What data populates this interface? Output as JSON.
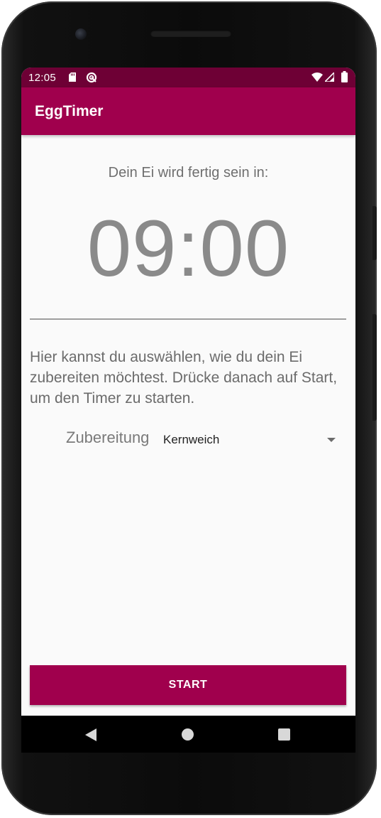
{
  "status_bar": {
    "time": "12:05",
    "icons": [
      "sd-card-icon",
      "sync-icon",
      "wifi-icon",
      "signal-icon",
      "battery-icon"
    ],
    "background": "#6e0035"
  },
  "app_bar": {
    "title": "EggTimer",
    "background": "#a0004d"
  },
  "main": {
    "subtitle": "Dein Ei wird fertig sein in:",
    "timer": "09:00",
    "info": "Hier kannst du auswählen, wie du dein Ei zubereiten möchtest. Drücke danach auf Start, um den Timer zu starten.",
    "preparation_label": "Zubereitung",
    "preparation_value": "Kernweich",
    "preparation_dropdown_icon": "arrow-drop-down-icon"
  },
  "start_button": {
    "label": "START",
    "color": "#a0004d"
  },
  "nav_bar": {
    "icons": [
      "back-icon",
      "home-icon",
      "recents-icon"
    ]
  }
}
